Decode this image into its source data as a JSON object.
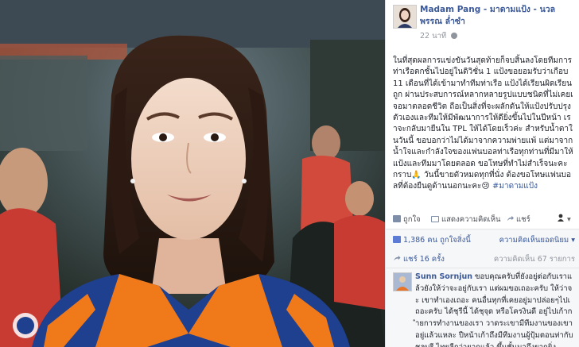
{
  "post": {
    "author": "Madam Pang - มาดามแป้ง - นวลพรรณ ล่ำซำ",
    "time": "22 นาที",
    "text": "ในที่สุดผลการแข่งขันวันสุดท้ายก็จบสิ้นลงโดยทีมการท่าเรือตกชั้นไปอยู่ในดิวิชั่น 1 แป้งขอยอมรับว่าเกือบ 11 เดือนที่ได้เข้ามาทำทีมท่าเรือ แป้งได้เรียนผิดเรียนถูก ผ่านประสบการณ์หลากหลายรูปแบบชนิดที่ไม่เคยเจอมาตลอดชีวิต ถือเป็นสิ่งที่จะผลักดันให้แป้งปรับปรุงตัวเองและทีมให้มีพัฒนาการให้ดียิ่งขึ้นไปในปีหน้า เราจะกลับมายืนใน TPL ให้ได้โดยเร็วค่ะ สำหรับน้ำตาในวันนี้ ขอบอกว่าไม่ได้มาจากความพ่ายแพ้ แต่มาจากน้ำใจและกำลังใจของแฟนบอลท่าเรือทุกท่านที่มีมาให้แป้งและทีมมาโดยตลอด ขอโทษที่ทำไม่สำเร็จนะคะ กราบ🙏 วันนี้ขายตัวหมดทุกที่นั่ง ต้องขอโทษแฟนบอลที่ต้องยืนดูด้านนอกนะคะ😢 ",
    "hashtag": "#มาดามแป้ง"
  },
  "actions": {
    "like": "ถูกใจ",
    "comment": "แสดงความคิดเห็น",
    "share": "แชร์"
  },
  "stats": {
    "likes": "1,386 คน ถูกใจสิ่งนี้",
    "sort": "ความคิดเห็นยอดนิยม",
    "shares": "แชร์ 16 ครั้ง",
    "comments_count": "ความคิดเห็น 67 รายการ"
  },
  "comment": {
    "name": "Sunn Sornjun",
    "text": "ขอบคุณครับที่ยังอยู่ต่อกับเราแล้วยังให้ว่าจะอยู่กับเรา แต่ผมขอเถอะครับ ให้ว่าจะ เขาทำเองเถอะ คนอื่นทุกที่เคยอยู่มาปล่อยๆไปเถอะครับ ได้ชุรีนี้ ได้ชุจุด หรือโครงินดี อยู่ไปเก้ากำยการทำงานของเรา วาดระเขามีทีมงานของเขาอยู่แล้วแหละ ปีหน้าเก้าถึงมีทีมงานผู้ปุ้มตอนท่ากับชลบุรี ไทยลีกว่ายากแล้ว ขึ้นชั้นมาถึงยากยิ่ง"
  },
  "colors": {
    "fb_blue": "#3b5998",
    "jersey_blue": "#1f3f8f",
    "jersey_orange": "#f07a1a"
  }
}
